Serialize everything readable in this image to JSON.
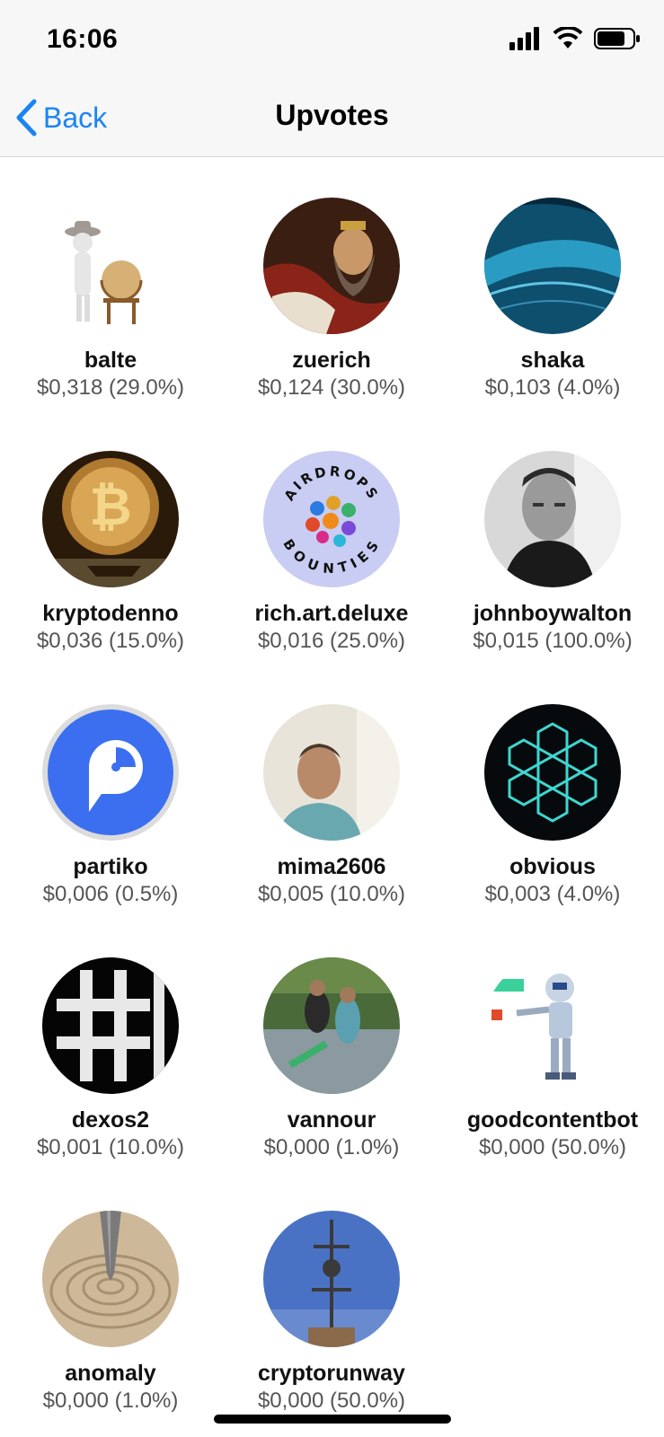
{
  "status_bar": {
    "time": "16:06"
  },
  "nav": {
    "back_label": "Back",
    "title": "Upvotes"
  },
  "voters": [
    {
      "name": "balte",
      "amount": "$0,318 (29.0%)",
      "avatar": "globe-figure"
    },
    {
      "name": "zuerich",
      "amount": "$0,124 (30.0%)",
      "avatar": "painting-portrait"
    },
    {
      "name": "shaka",
      "amount": "$0,103 (4.0%)",
      "avatar": "blue-wave"
    },
    {
      "name": "kryptodenno",
      "amount": "$0,036 (15.0%)",
      "avatar": "bitcoin-coin"
    },
    {
      "name": "rich.art.deluxe",
      "amount": "$0,016 (25.0%)",
      "avatar": "airdrops-bounties"
    },
    {
      "name": "johnboywalton",
      "amount": "$0,015 (100.0%)",
      "avatar": "bw-portrait"
    },
    {
      "name": "partiko",
      "amount": "$0,006 (0.5%)",
      "avatar": "partiko-logo"
    },
    {
      "name": "mima2606",
      "amount": "$0,005 (10.0%)",
      "avatar": "man-portrait"
    },
    {
      "name": "obvious",
      "amount": "$0,003 (4.0%)",
      "avatar": "neon-hexagons"
    },
    {
      "name": "dexos2",
      "amount": "$0,001 (10.0%)",
      "avatar": "hashtag"
    },
    {
      "name": "vannour",
      "amount": "$0,000 (1.0%)",
      "avatar": "river-people"
    },
    {
      "name": "goodcontentbot",
      "amount": "$0,000 (50.0%)",
      "avatar": "robot"
    },
    {
      "name": "anomaly",
      "amount": "$0,000 (1.0%)",
      "avatar": "sand-spiral"
    },
    {
      "name": "cryptorunway",
      "amount": "$0,000 (50.0%)",
      "avatar": "sky-sculpture"
    }
  ],
  "avatar_text": {
    "airdrops": "AIRDROPS",
    "bounties": "BOUNTIES"
  },
  "colors": {
    "accent": "#1a84f4",
    "partiko_blue": "#3b6ff0"
  }
}
